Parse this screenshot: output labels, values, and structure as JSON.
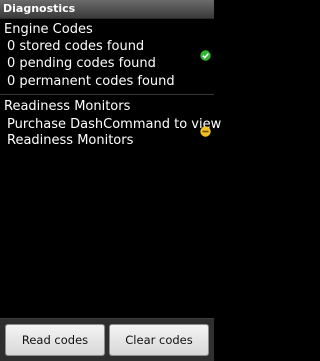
{
  "titlebar": {
    "title": "Diagnostics"
  },
  "engine_codes": {
    "heading": "Engine Codes",
    "lines": [
      "0 stored codes found",
      "0 pending codes found",
      "0 permanent codes found"
    ],
    "status_icon": "check-circle-icon",
    "status_color": "#2db82d"
  },
  "readiness": {
    "heading": "Readiness Monitors",
    "lines": [
      "Purchase DashCommand to view",
      "Readiness Monitors"
    ],
    "status_icon": "minus-circle-icon",
    "status_color": "#f0c020"
  },
  "actions": {
    "read_label": "Read codes",
    "clear_label": "Clear codes"
  }
}
